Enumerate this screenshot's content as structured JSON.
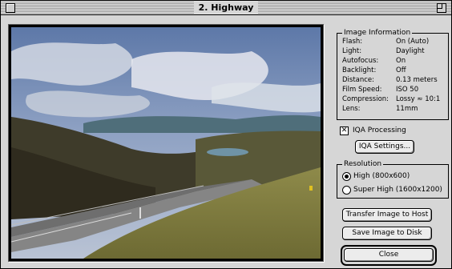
{
  "window": {
    "title": "2. Highway"
  },
  "image_info": {
    "title": "Image Information",
    "rows": [
      {
        "label": "Flash:",
        "value": "On (Auto)"
      },
      {
        "label": "Light:",
        "value": "Daylight"
      },
      {
        "label": "Autofocus:",
        "value": "On"
      },
      {
        "label": "Backlight:",
        "value": "Off"
      },
      {
        "label": "Distance:",
        "value": "0.13 meters"
      },
      {
        "label": "Film Speed:",
        "value": "ISO 50"
      },
      {
        "label": "Compression:",
        "value": "Lossy ≈ 10:1"
      },
      {
        "label": "Lens:",
        "value": "11mm"
      }
    ]
  },
  "iqa": {
    "checkbox_label": "IQA Processing",
    "checked": true,
    "check_mark": "✕",
    "settings_button": "IQA Settings..."
  },
  "resolution": {
    "title": "Resolution",
    "options": [
      {
        "label": "High (800x600)",
        "selected": true
      },
      {
        "label": "Super High (1600x1200)",
        "selected": false
      }
    ]
  },
  "buttons": {
    "transfer": "Transfer Image to Host",
    "save": "Save Image to Disk",
    "close": "Close"
  }
}
